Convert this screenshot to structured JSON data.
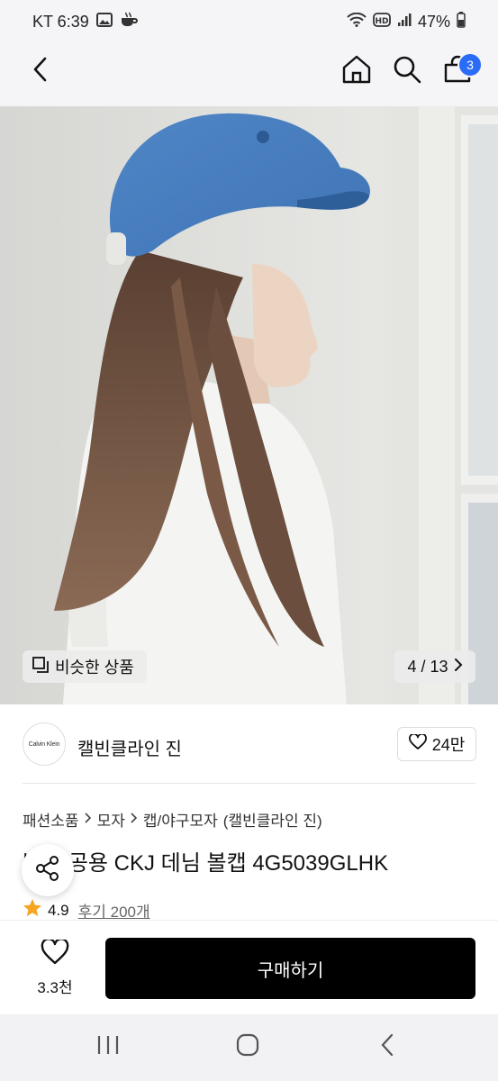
{
  "status_bar": {
    "carrier_time": "KT 6:39",
    "battery": "47%",
    "left_icons": [
      "gallery-icon",
      "coffee-icon"
    ],
    "right_icons": [
      "wifi-icon",
      "hd-icon",
      "signal-icon",
      "battery-icon"
    ]
  },
  "nav": {
    "back_icon": "back-arrow-icon",
    "home_icon": "home-icon",
    "search_icon": "search-icon",
    "cart_icon": "shopping-bag-icon",
    "cart_badge": "3",
    "badge_color": "#2b6cf6"
  },
  "gallery": {
    "similar_label": "비슷한 상품",
    "counter": "4 / 13"
  },
  "brand": {
    "logo_text": "Calvin Klein",
    "name": "캘빈클라인 진",
    "likes": "24만"
  },
  "breadcrumb": [
    "패션소품",
    "모자",
    "캡/야구모자",
    "(캘빈클라인 진)"
  ],
  "product": {
    "title": "남녀 공용 CKJ 데님 볼캡 4G5039GLHK",
    "rating": "4.9",
    "reviews": "후기 200개",
    "star_color": "#f5a623"
  },
  "bottom": {
    "wish_count": "3.3천",
    "buy_label": "구매하기"
  },
  "system_nav": [
    "recents-icon",
    "home-circle-icon",
    "back-chevron-icon"
  ]
}
